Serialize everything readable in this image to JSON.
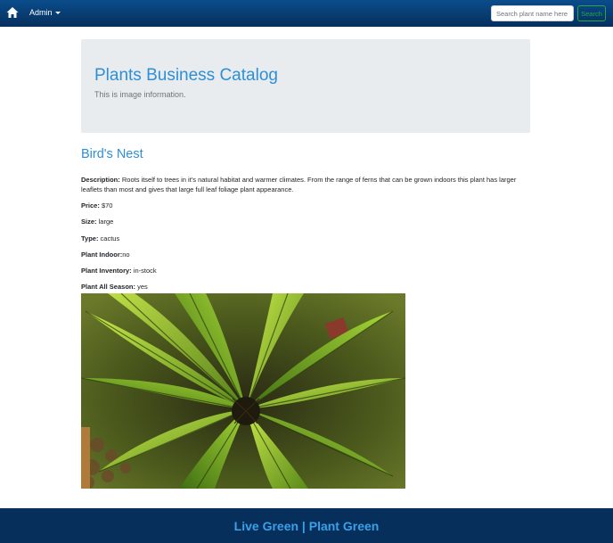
{
  "nav": {
    "home_icon": "home-icon",
    "admin_label": "Admin",
    "search_placeholder": "Search plant name here",
    "search_button": "Search",
    "colors": {
      "navbar": "#062f5c",
      "search_accent": "#28a745"
    }
  },
  "jumbotron": {
    "title": "Plants Business Catalog",
    "subtitle": "This is image information."
  },
  "plant": {
    "name": "Bird's Nest",
    "description_label": "Description:",
    "description": "Roots itself to trees in it's natural habitat and warmer climates. From the range of ferns that can be grown indoors this plant has larger leaflets than most and gives that large full leaf foliage plant appearance.",
    "price_label": "Price:",
    "price": "$70",
    "size_label": "Size:",
    "size": "large",
    "type_label": "Type:",
    "type": "cactus",
    "indoor_label": "Plant Indoor:",
    "indoor": "no",
    "inventory_label": "Plant Inventory:",
    "inventory": "in-stock",
    "season_label": "Plant All Season:",
    "season": "yes",
    "image_icon": "birds-nest-fern-photo"
  },
  "footer": {
    "text": "Live Green | Plant Green"
  },
  "colors": {
    "accent": "#2e8fd6",
    "jumbotron_bg": "#e9ecef",
    "footer_text": "#3aa0e8"
  }
}
